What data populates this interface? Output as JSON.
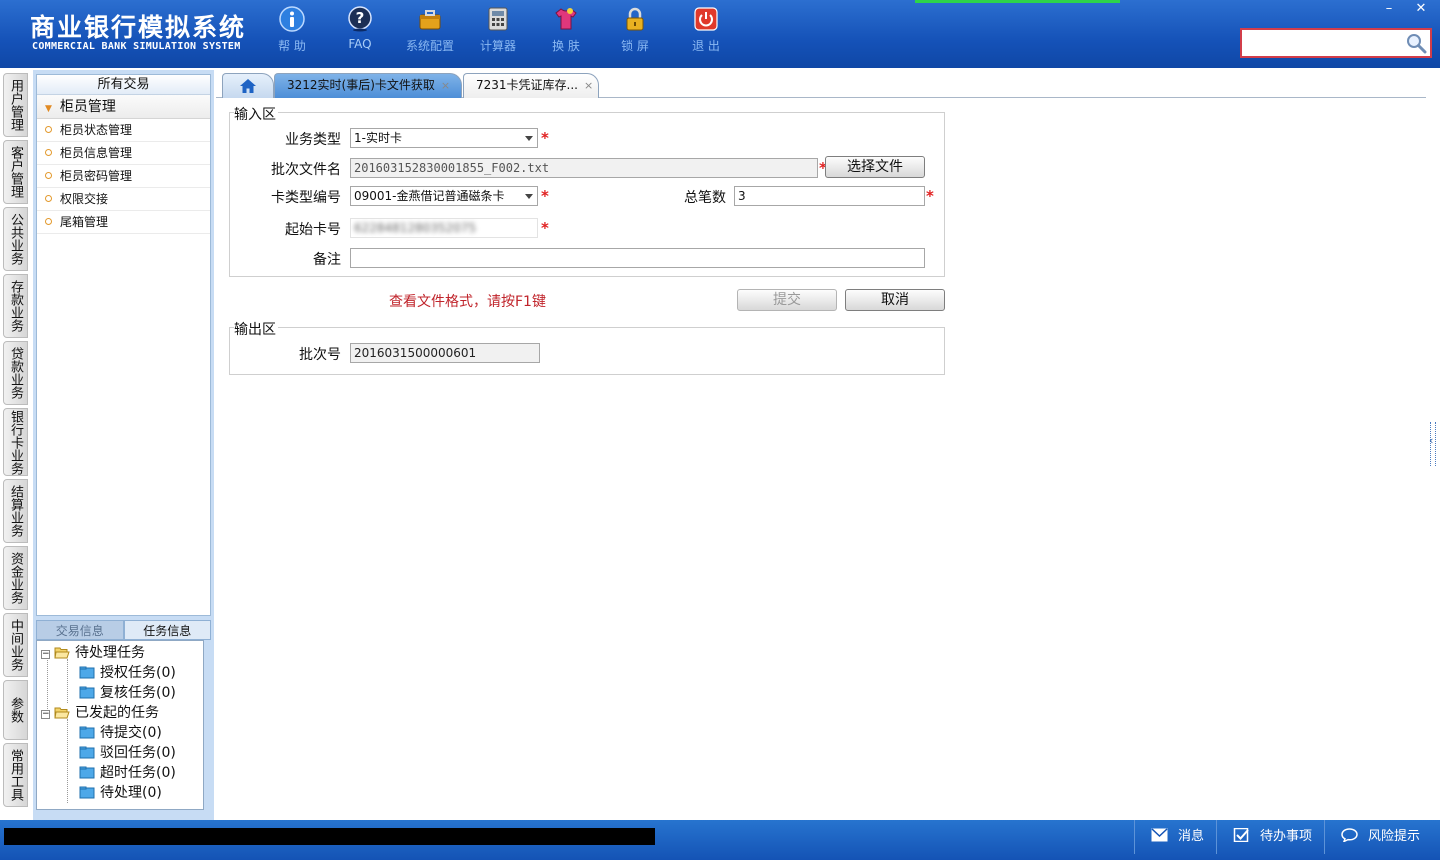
{
  "app": {
    "title_cn": "商业银行模拟系统",
    "title_en": "COMMERCIAL BANK SIMULATION SYSTEM"
  },
  "toolbar": [
    {
      "label": "帮 助",
      "icon": "info-icon"
    },
    {
      "label": "FAQ",
      "icon": "help-question-icon"
    },
    {
      "label": "系统配置",
      "icon": "toolbox-icon"
    },
    {
      "label": "计算器",
      "icon": "calculator-icon"
    },
    {
      "label": "换 肤",
      "icon": "tshirt-icon"
    },
    {
      "label": "锁 屏",
      "icon": "lock-icon"
    },
    {
      "label": "退 出",
      "icon": "power-icon"
    }
  ],
  "window_controls": {
    "minimize": "–",
    "close": "✕"
  },
  "search": {
    "value": ""
  },
  "vertical_tabs": [
    "用户管理",
    "客户管理",
    "公共业务",
    "存款业务",
    "贷款业务",
    "银行卡业务",
    "结算业务",
    "资金业务",
    "中间业务",
    "参数",
    "常用工具"
  ],
  "sidebar": {
    "title": "所有交易",
    "group": "柜员管理",
    "items": [
      "柜员状态管理",
      "柜员信息管理",
      "柜员密码管理",
      "权限交接",
      "尾箱管理"
    ]
  },
  "task_panel": {
    "tabs": [
      "交易信息",
      "任务信息"
    ],
    "tree": {
      "pending": "待处理任务",
      "pending_children": [
        "授权任务(0)",
        "复核任务(0)"
      ],
      "initiated": "已发起的任务",
      "initiated_children": [
        "待提交(0)",
        "驳回任务(0)",
        "超时任务(0)",
        "待处理(0)"
      ]
    }
  },
  "tabs": {
    "home_icon": "home-icon",
    "active": "3212实时(事后)卡文件获取",
    "inactive": "7231卡凭证库存...",
    "close": "×"
  },
  "form": {
    "input_section": "输入区",
    "output_section": "输出区",
    "business_type": {
      "label": "业务类型",
      "value": "1-实时卡"
    },
    "batch_file": {
      "label": "批次文件名",
      "value": "201603152830001855_F002.txt",
      "button": "选择文件"
    },
    "card_type": {
      "label": "卡类型编号",
      "value": "09001-金燕借记普通磁条卡"
    },
    "total_count": {
      "label": "总笔数",
      "value": "3"
    },
    "start_card": {
      "label": "起始卡号",
      "value": "6228481280352075"
    },
    "remark": {
      "label": "备注",
      "value": ""
    },
    "required_mark": "*",
    "hint": "查看文件格式，请按F1键",
    "submit": "提交",
    "cancel": "取消",
    "batch_no": {
      "label": "批次号",
      "value": "2016031500000601"
    }
  },
  "statusbar": {
    "messages": "消息",
    "todo": "待办事项",
    "risk": "风险提示"
  },
  "colors": {
    "header_blue": "#1552b8",
    "active_tab": "#4d8ed7",
    "hint_red": "#c0242b",
    "required_red": "#e12020",
    "search_border": "#d23d4a"
  }
}
